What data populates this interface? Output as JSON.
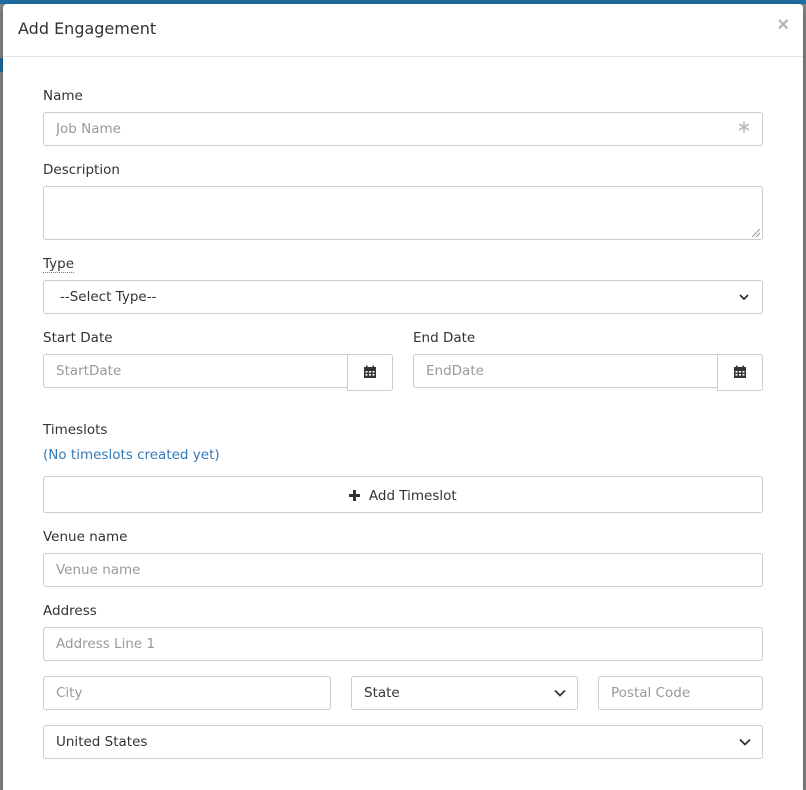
{
  "modal": {
    "title": "Add Engagement",
    "close": "×"
  },
  "form": {
    "name": {
      "label": "Name",
      "placeholder": "Job Name",
      "required_icon": "asterisk-icon"
    },
    "description": {
      "label": "Description",
      "value": ""
    },
    "type": {
      "label": "Type",
      "selected": "--Select Type--"
    },
    "start_date": {
      "label": "Start Date",
      "placeholder": "StartDate",
      "icon": "calendar-icon"
    },
    "end_date": {
      "label": "End Date",
      "placeholder": "EndDate",
      "icon": "calendar-icon"
    },
    "timeslots": {
      "label": "Timeslots",
      "empty_text": "(No timeslots created yet)",
      "add_button": "Add Timeslot",
      "add_icon": "plus-icon"
    },
    "venue": {
      "label": "Venue name",
      "placeholder": "Venue name"
    },
    "address": {
      "label": "Address",
      "line1_placeholder": "Address Line 1",
      "city_placeholder": "City",
      "state_selected": "State",
      "postal_placeholder": "Postal Code",
      "country_selected": "United States"
    }
  },
  "colors": {
    "link": "#337ab7",
    "border": "#cccccc",
    "placeholder": "#999999"
  }
}
